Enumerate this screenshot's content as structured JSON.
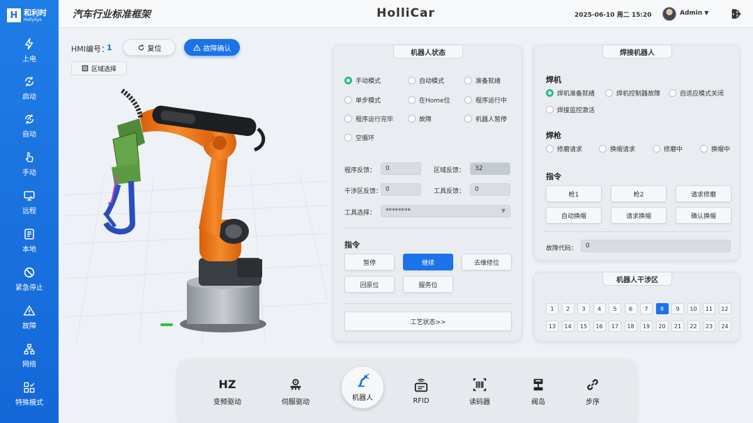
{
  "logo": {
    "mark": "H",
    "name": "和利时",
    "sub": "HollySys"
  },
  "header": {
    "title": "汽车行业标准框架",
    "brand": "HolliCar",
    "datetime": "2025-06-10 周二 15:20",
    "user": "Admin"
  },
  "sidebar": {
    "items": [
      {
        "label": "上电",
        "icon": "lightning-icon"
      },
      {
        "label": "启动",
        "icon": "power-cycle-icon"
      },
      {
        "label": "自动",
        "icon": "auto-cycle-icon"
      },
      {
        "label": "手动",
        "icon": "hand-icon"
      },
      {
        "label": "远程",
        "icon": "remote-monitor-icon"
      },
      {
        "label": "本地",
        "icon": "local-doc-icon"
      },
      {
        "label": "紧急停止",
        "icon": "stop-icon"
      },
      {
        "label": "故障",
        "icon": "warning-icon"
      },
      {
        "label": "网络",
        "icon": "network-icon"
      },
      {
        "label": "特殊模式",
        "icon": "special-mode-icon"
      }
    ]
  },
  "hmi": {
    "label": "HMI编号：",
    "number": "1",
    "reset": "复位",
    "fault_ack": "故障确认",
    "zone_select": "区域选择"
  },
  "robot_status": {
    "title": "机器人状态",
    "modes": [
      {
        "label": "手动模式",
        "on": true
      },
      {
        "label": "自动模式",
        "on": false
      },
      {
        "label": "准备就绪",
        "on": false
      },
      {
        "label": "单步模式",
        "on": false
      },
      {
        "label": "在Home位",
        "on": false
      },
      {
        "label": "程序运行中",
        "on": false
      },
      {
        "label": "程序运行完毕",
        "on": false
      },
      {
        "label": "故障",
        "on": false
      },
      {
        "label": "机器人暂停",
        "on": false
      },
      {
        "label": "空循环",
        "on": false
      }
    ],
    "program_fb_label": "程序反馈：",
    "program_fb": "0",
    "zone_fb_label": "区域反馈：",
    "zone_fb": "32",
    "interf_fb_label": "干涉区反馈：",
    "interf_fb": "0",
    "tool_fb_label": "工具反馈：",
    "tool_fb": "0",
    "tool_select_label": "工具选择：",
    "tool_select": "********",
    "cmd_title": "指令",
    "cmds": [
      "暂停",
      "继续",
      "去维修位",
      "回原位",
      "服务位"
    ],
    "process_btn": "工艺状态>>"
  },
  "welding": {
    "title": "焊接机器人",
    "welder_title": "焊机",
    "welder": [
      {
        "label": "焊机准备就绪",
        "on": true
      },
      {
        "label": "焊机控制器故障",
        "on": false
      },
      {
        "label": "自适应模式关闭",
        "on": false
      },
      {
        "label": "焊接监控激活",
        "on": false
      }
    ],
    "gun_title": "焊枪",
    "gun": [
      {
        "label": "修磨请求",
        "on": false
      },
      {
        "label": "换帽请求",
        "on": false
      },
      {
        "label": "修磨中",
        "on": false
      },
      {
        "label": "换帽中",
        "on": false
      }
    ],
    "cmd_title": "指令",
    "cmds": [
      "枪1",
      "枪2",
      "请求修磨",
      "自动换帽",
      "请求换帽",
      "确认换帽"
    ],
    "fault_label": "故障代码：",
    "fault_code": "0"
  },
  "interference": {
    "title": "机器人干涉区",
    "zones": [
      "1",
      "2",
      "3",
      "4",
      "5",
      "6",
      "7",
      "8",
      "9",
      "10",
      "11",
      "12",
      "13",
      "14",
      "15",
      "16",
      "17",
      "18",
      "19",
      "20",
      "21",
      "22",
      "23",
      "24"
    ],
    "active": "8"
  },
  "bottom_nav": [
    {
      "label": "变频驱动",
      "icon": "hz-icon",
      "glyph": "HZ"
    },
    {
      "label": "伺服驱动",
      "icon": "servo-icon"
    },
    {
      "label": "机器人",
      "icon": "robot-arm-icon"
    },
    {
      "label": "RFID",
      "icon": "rfid-icon"
    },
    {
      "label": "读码器",
      "icon": "barcode-icon"
    },
    {
      "label": "阀岛",
      "icon": "valve-icon"
    },
    {
      "label": "步序",
      "icon": "chain-link-icon"
    }
  ],
  "colors": {
    "primary": "#1a73e8",
    "sidebar": "#1f7de6",
    "radio_on": "#1fbf7a",
    "robot_orange": "#f07a1a"
  }
}
